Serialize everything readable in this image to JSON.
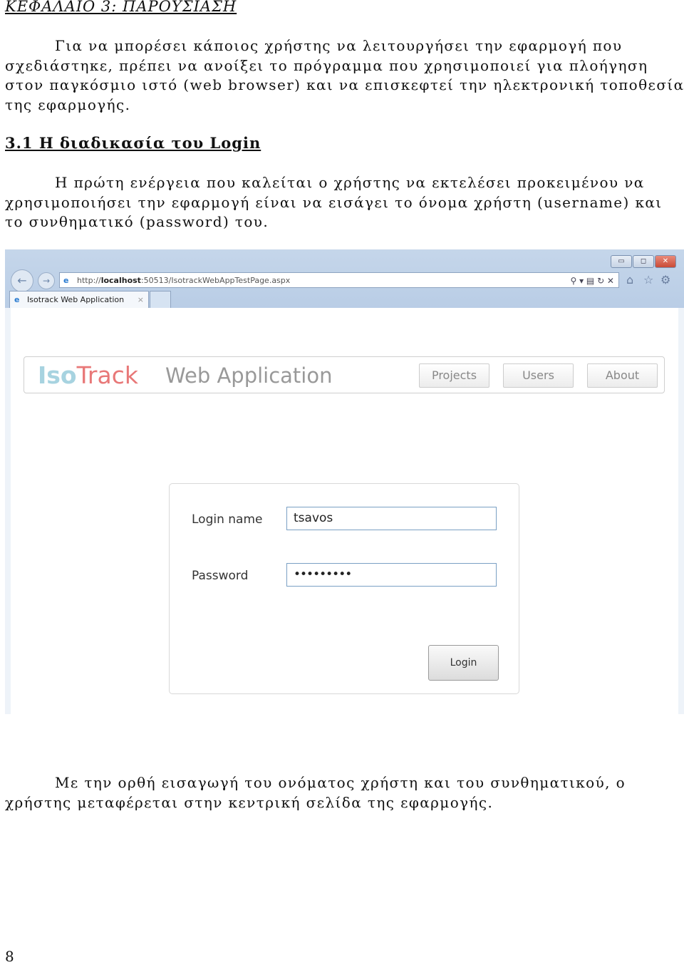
{
  "chapter_title": "ΚΕΦΑΛΑΙΟ 3: ΠΑΡΟΥΣΙΑΣΗ",
  "para1": "Για να μπορέσει κάποιος χρήστης να λειτουργήσει την εφαρμογή που σχεδιάστηκε, πρέπει να ανοίξει το πρόγραμμα που χρησιμοποιεί για πλοήγηση στον παγκόσμιο ιστό (web browser) και να επισκεφτεί την ηλεκτρονική τοποθεσία της εφαρμογής.",
  "section_title": "3.1 Η διαδικασία του Login",
  "para2": "Η πρώτη ενέργεια που καλείται ο χρήστης να εκτελέσει προκειμένου να χρησιμοποιήσει την εφαρμογή είναι να εισάγει το όνομα χρήστη (username) και το συνθηματικό (password) του.",
  "browser": {
    "url_prefix": "http://",
    "url_host": "localhost",
    "url_rest": ":50513/IsotrackWebAppTestPage.aspx",
    "tab_title": "Isotrack Web Application",
    "tab_close": "×"
  },
  "app": {
    "logo_iso": "Iso",
    "logo_track": "Track",
    "subtitle": "Web Application",
    "nav": [
      "Projects",
      "Users",
      "About"
    ],
    "login_label": "Login name",
    "login_value": "tsavos",
    "password_label": "Password",
    "password_value": "•••••••••",
    "login_button": "Login"
  },
  "colors": {
    "iso": "#a7d3e0",
    "track": "#e87878"
  },
  "para3": "Με την ορθή εισαγωγή του ονόματος χρήστη και του συνθηματικού, ο χρήστης μεταφέρεται στην κεντρική σελίδα της εφαρμογής.",
  "page_number": "8"
}
